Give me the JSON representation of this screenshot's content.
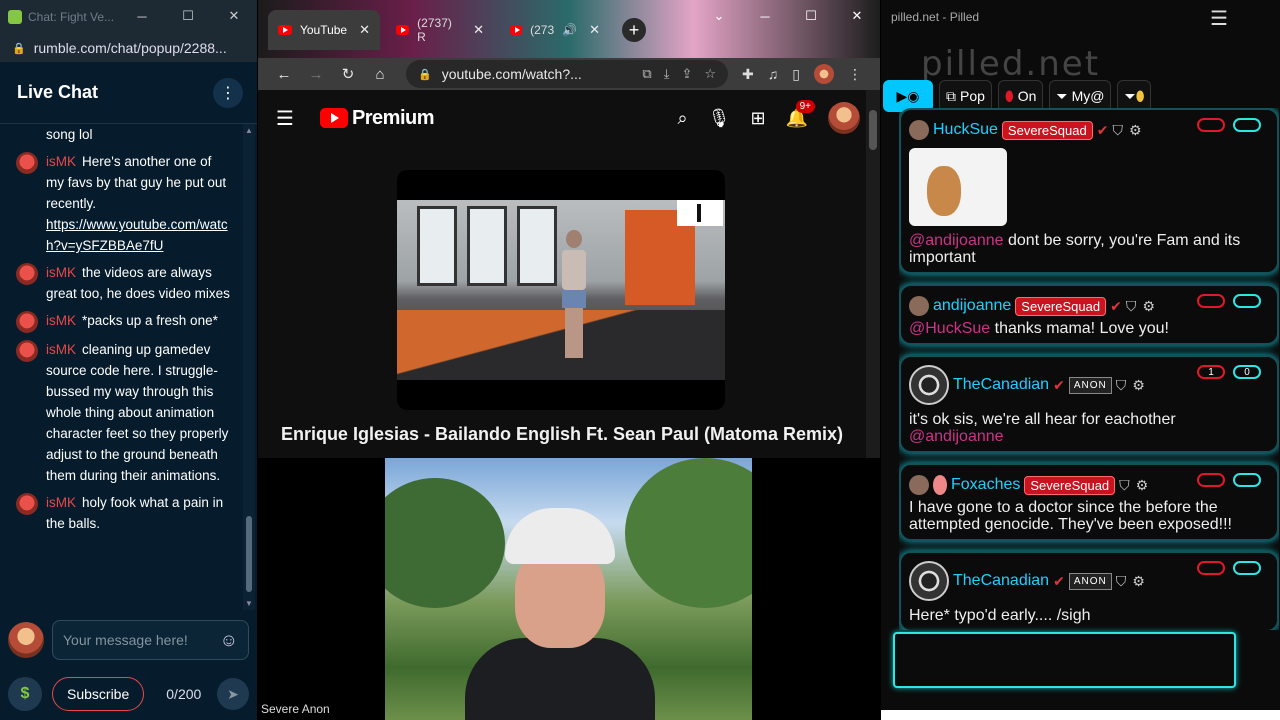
{
  "rumble": {
    "window_title": "Chat: Fight Ve...",
    "url": "rumble.com/chat/popup/2288...",
    "header_title": "Live Chat",
    "messages": [
      {
        "user": "",
        "text": "song lol"
      },
      {
        "user": "isMK",
        "text": "Here's another one of my favs by that guy he put out recently.",
        "link": "https://www.youtube.com/watch?v=ySFZBBAe7fU"
      },
      {
        "user": "isMK",
        "text": "the videos are always great too, he does video mixes"
      },
      {
        "user": "isMK",
        "text": "*packs up a fresh one*"
      },
      {
        "user": "isMK",
        "text": "cleaning up gamedev source code here. I struggle-bussed my way through this whole thing about animation character feet so they properly adjust to the ground beneath them during their animations."
      },
      {
        "user": "isMK",
        "text": "holy fook what a pain in the balls."
      }
    ],
    "input_placeholder": "Your message here!",
    "subscribe_label": "Subscribe",
    "char_count": "0/200",
    "dollar_label": "$"
  },
  "youtube": {
    "tabs": [
      {
        "label": "YouTube"
      },
      {
        "label": "(2737) R"
      },
      {
        "label": "(273"
      }
    ],
    "url": "youtube.com/watch?...",
    "logo_text": "Premium",
    "notification_count": "9+",
    "video_title": "Enrique Iglesias - Bailando English Ft. Sean Paul (Matoma Remix)"
  },
  "webcam": {
    "label": "Severe Anon"
  },
  "pilled": {
    "window_title": "pilled.net - Pilled",
    "brand": "pilled.net",
    "toolbar": {
      "pop_label": "Pop",
      "on_label": "On",
      "my_label": "My@"
    },
    "cards": [
      {
        "user": "HuckSue",
        "tag": "SevereSquad",
        "mention": "@andijoanne",
        "text": "dont be sorry, you're Fam and its important"
      },
      {
        "user": "andijoanne",
        "tag": "SevereSquad",
        "mention": "@HuckSue",
        "text": "thanks mama! Love you!"
      },
      {
        "user": "TheCanadian",
        "badge": "ANON",
        "text": "it's ok sis, we're all hear for eachother",
        "mention": "@andijoanne",
        "pill_left": "1",
        "pill_right": "0"
      },
      {
        "user": "Foxaches",
        "tag": "SevereSquad",
        "text": "I have gone to a doctor since the before the attempted genocide. They've been exposed!!!"
      },
      {
        "user": "TheCanadian",
        "badge": "ANON",
        "text": "Here* typo'd early.... /sigh"
      }
    ]
  }
}
